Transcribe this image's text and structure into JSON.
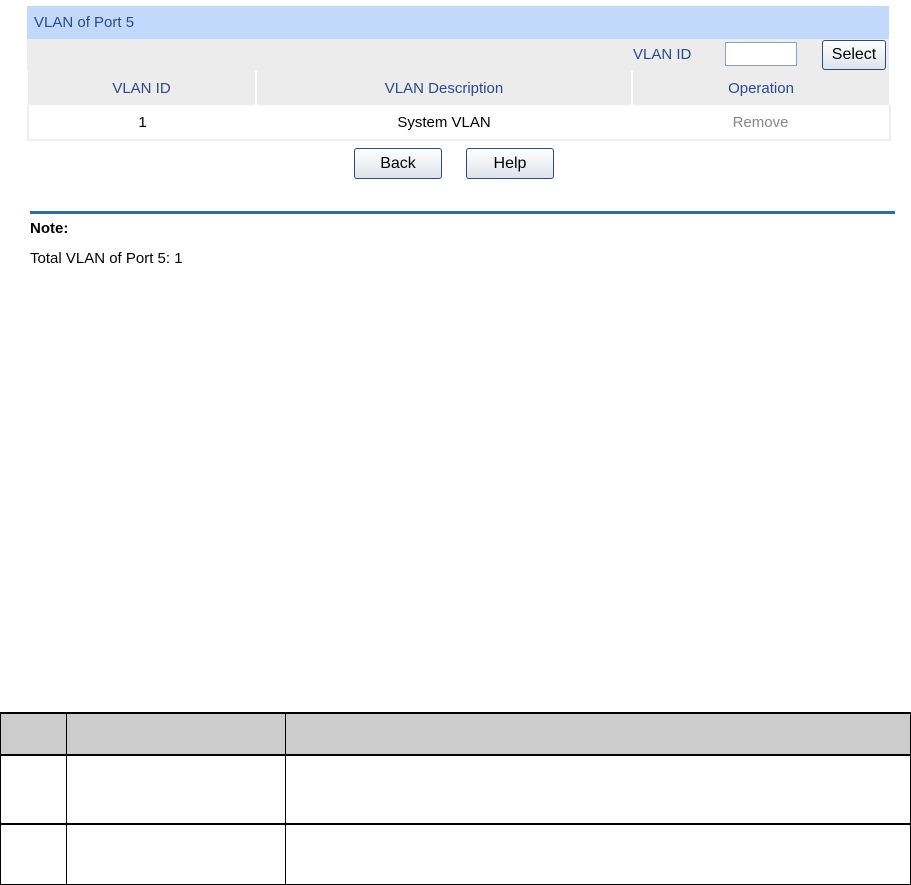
{
  "panel": {
    "title": "VLAN of Port 5",
    "vlan_id_label": "VLAN ID",
    "vlan_id_value": "",
    "select_label": "Select"
  },
  "table": {
    "headers": [
      "VLAN ID",
      "VLAN Description",
      "Operation"
    ],
    "rows": [
      {
        "id": "1",
        "description": "System VLAN",
        "operation": "Remove"
      }
    ]
  },
  "buttons": {
    "back": "Back",
    "help": "Help"
  },
  "note": {
    "title": "Note:",
    "text": "Total VLAN of Port 5: 1"
  },
  "colors": {
    "title_bg": "#c2d8fc",
    "header_bg": "#ececec",
    "label": "#2a4a8a",
    "rule": "#2a6fa0"
  }
}
